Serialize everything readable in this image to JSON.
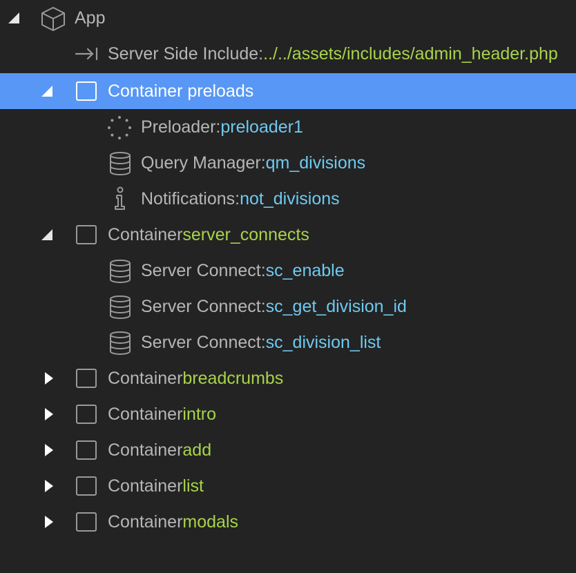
{
  "tree": {
    "app": {
      "label": "App",
      "icon": "cube-icon"
    },
    "ssi": {
      "key": "Server Side Include: ",
      "value": "../../assets/includes/admin_header.php",
      "icon": "arrow-right-bar-icon"
    },
    "preloads": {
      "key": "Container preloads",
      "value": ""
    },
    "preloader": {
      "key": "Preloader: ",
      "value": "preloader1",
      "icon": "spinner-dots-icon"
    },
    "query_manager": {
      "key": "Query Manager: ",
      "value": "qm_divisions",
      "icon": "database-icon"
    },
    "notifications": {
      "key": "Notifications: ",
      "value": "not_divisions",
      "icon": "info-icon"
    },
    "server_connects": {
      "key": "Container ",
      "value": "server_connects"
    },
    "sc_enable": {
      "key": "Server Connect: ",
      "value": "sc_enable",
      "icon": "database-icon"
    },
    "sc_get_division_id": {
      "key": "Server Connect: ",
      "value": "sc_get_division_id",
      "icon": "database-icon"
    },
    "sc_division_list": {
      "key": "Server Connect: ",
      "value": "sc_division_list",
      "icon": "database-icon"
    },
    "breadcrumbs": {
      "key": "Container ",
      "value": "breadcrumbs"
    },
    "intro": {
      "key": "Container ",
      "value": "intro"
    },
    "add": {
      "key": "Container ",
      "value": "add"
    },
    "list": {
      "key": "Container ",
      "value": "list"
    },
    "modals": {
      "key": "Container ",
      "value": "modals"
    }
  },
  "colors": {
    "background": "#232323",
    "selected": "#5897f5",
    "text": "#b6b6b6",
    "value_green": "#a8d34a",
    "value_blue": "#6fc9f0"
  }
}
